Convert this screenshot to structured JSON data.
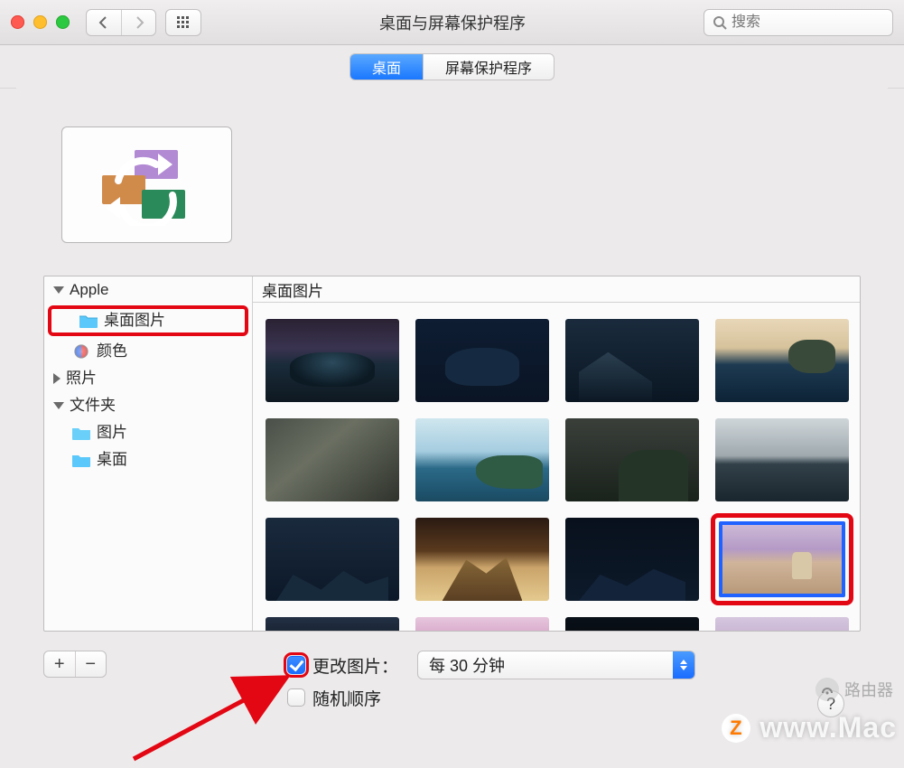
{
  "window": {
    "title": "桌面与屏幕保护程序"
  },
  "toolbar": {
    "back_icon": "chevron-left-icon",
    "forward_icon": "chevron-right-icon",
    "grid_icon": "grid-icon",
    "search_placeholder": "搜索"
  },
  "tabs": {
    "desktop": "桌面",
    "screensaver": "屏幕保护程序",
    "active": "desktop"
  },
  "sidebar": {
    "groups": [
      {
        "label": "Apple",
        "expanded": true,
        "items": [
          {
            "label": "桌面图片",
            "icon": "folder-icon",
            "highlight": true
          },
          {
            "label": "颜色",
            "icon": "color-wheel-icon"
          }
        ]
      },
      {
        "label": "照片",
        "expanded": false,
        "items": []
      },
      {
        "label": "文件夹",
        "expanded": true,
        "items": [
          {
            "label": "图片",
            "icon": "folder-icon"
          },
          {
            "label": "桌面",
            "icon": "folder-icon"
          }
        ]
      }
    ]
  },
  "content": {
    "header": "桌面图片",
    "selected_index": 11
  },
  "controls": {
    "add_label": "+",
    "remove_label": "−",
    "change_picture_label": "更改图片：",
    "change_picture_checked": true,
    "interval_value": "每 30 分钟",
    "random_label": "随机顺序",
    "random_checked": false,
    "help_label": "?"
  },
  "watermark": {
    "router_label": "路由器",
    "main": "www.Mac"
  }
}
